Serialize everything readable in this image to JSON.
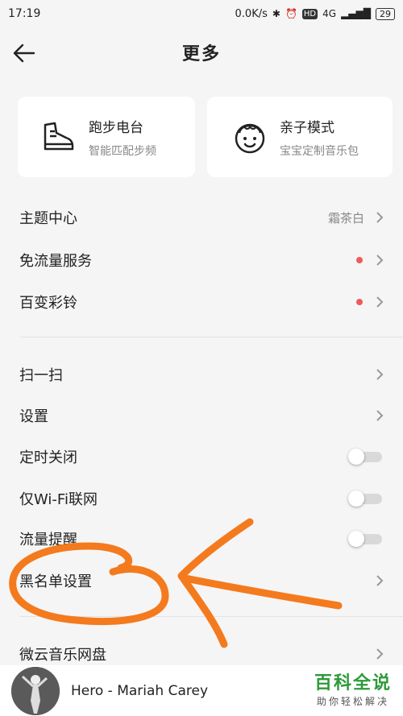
{
  "status": {
    "time": "17:19",
    "speed": "0.0K/s",
    "network": "4G",
    "hd": "HD",
    "battery": "29"
  },
  "header": {
    "title": "更多"
  },
  "cards": [
    {
      "title": "跑步电台",
      "subtitle": "智能匹配步频",
      "icon": "running-shoe-icon"
    },
    {
      "title": "亲子模式",
      "subtitle": "宝宝定制音乐包",
      "icon": "baby-face-icon"
    }
  ],
  "menu": {
    "theme": {
      "label": "主题中心",
      "value": "霜茶白"
    },
    "free_data": {
      "label": "免流量服务"
    },
    "ringtone": {
      "label": "百变彩铃"
    },
    "scan": {
      "label": "扫一扫"
    },
    "settings": {
      "label": "设置"
    },
    "sleep_timer": {
      "label": "定时关闭",
      "on": false
    },
    "wifi_only": {
      "label": "仅Wi-Fi联网",
      "on": false
    },
    "data_alert": {
      "label": "流量提醒",
      "on": false
    },
    "blacklist": {
      "label": "黑名单设置"
    },
    "cloud_drive": {
      "label": "微云音乐网盘"
    }
  },
  "player": {
    "song": "Hero - Mariah Carey"
  },
  "watermark": {
    "main": "百科全说",
    "sub": "助你轻松解决"
  },
  "colors": {
    "dot": "#f05a5a",
    "annotation": "#f47a1e",
    "watermark": "#2d9a3a"
  }
}
